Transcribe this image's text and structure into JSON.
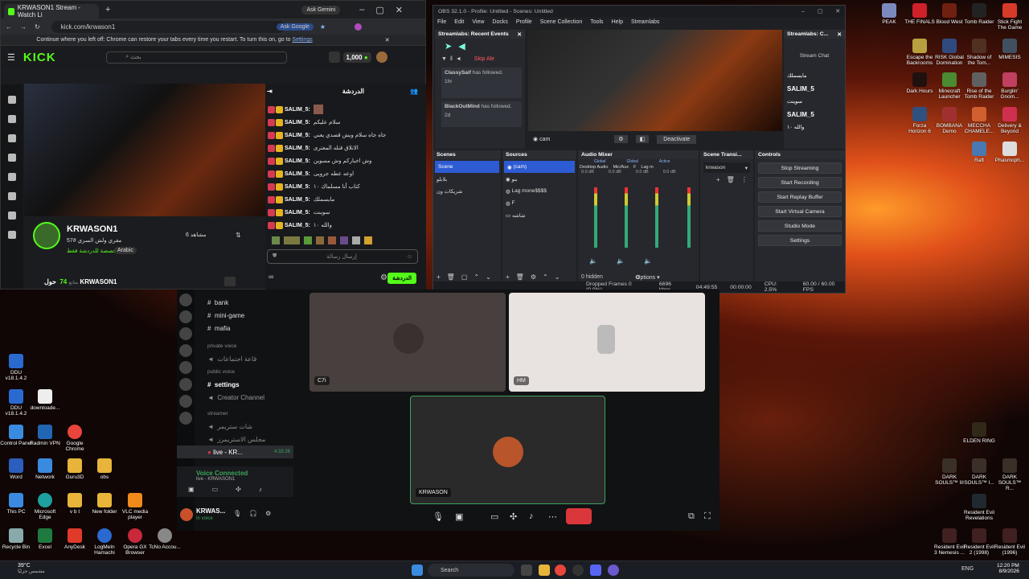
{
  "chrome": {
    "tab_title": "KRWASON1 Stream - Watch Li",
    "ask_gemini": "Ask Gemini",
    "url": "kick.com/krwason1",
    "ask_google": "Ask Google",
    "infobar": "Continue where you left off: Chrome can restore your tabs every time you restart. To turn this on, go to",
    "infobar_link": "Settings",
    "search_placeholder": "بحث",
    "coins": "1,000",
    "chat_title": "الدردشة",
    "streamer": "KRWASON1",
    "stream_title": "مفري ولش السري #57",
    "category": "مخصصة للدردشة فقط",
    "lang": "Arabic",
    "viewers": "6 مشاهد",
    "about": "حول KRWASON1",
    "followers_count": "74",
    "followers_label": "متابع",
    "chat_placeholder": "إرسال رسالة",
    "send_label": "الدردشة",
    "messages": [
      {
        "user": "SALIM_5:",
        "text": ""
      },
      {
        "user": "SALIM_5:",
        "text": "سلام عليكم"
      },
      {
        "user": "SALIM_5:",
        "text": "جاه جاه سلام ويش قصدي يعني"
      },
      {
        "user": "SALIM_5:",
        "text": "الاتلاق قتله المعترى"
      },
      {
        "user": "SALIM_5:",
        "text": "وش اخبارکم وش مسوين"
      },
      {
        "user": "SALIM_5:",
        "text": "اوعه عطه جرويى"
      },
      {
        "user": "SALIM_5:",
        "text": "كتاب أنا مسلماك ١٠"
      },
      {
        "user": "SALIM_5:",
        "text": "مايسملك"
      },
      {
        "user": "SALIM_5:",
        "text": "سوينت"
      },
      {
        "user": "SALIM_5:",
        "text": "والله ١٠"
      }
    ]
  },
  "obs": {
    "title": "OBS 32.1.0 - Profile: Untitled - Scenes: Untitled",
    "menu": [
      "File",
      "Edit",
      "View",
      "Docks",
      "Profile",
      "Scene Collection",
      "Tools",
      "Help",
      "Streamlabs"
    ],
    "events_title": "Streamlabs: Recent Events",
    "skip_label": "Skip Ale",
    "events": [
      {
        "name": "ClassySaif",
        "action": "has followed.",
        "time": "1hr"
      },
      {
        "name": "BlackOutMind",
        "action": "has followed.",
        "time": "2d"
      }
    ],
    "chat_dock_title": "Streamlabs: C...",
    "stream_chat": "Stream Chat",
    "chat_lines": [
      "مايسملك",
      "SALIM_5",
      "سوينت",
      "SALIM_5",
      "والله ١٠"
    ],
    "preview_source": "cam",
    "deactivate": "Deactivate",
    "scenes_title": "Scenes",
    "scenes": [
      "Scene",
      "بلابلو",
      "شريكات ون"
    ],
    "sources_title": "Sources",
    "sources": [
      "(cam)",
      "بنو",
      "Lag mone$$$$",
      "F",
      "شاشه"
    ],
    "mixer_title": "Audio Mixer",
    "mixer_tags": [
      "Global",
      "Global",
      "Active"
    ],
    "channels": [
      "Desktop Audio",
      "Mic/Aux",
      "F",
      "Lag m"
    ],
    "channel_db": [
      "0.0 dB",
      "0.0 dB",
      "0.0 dB",
      "0.0 dB"
    ],
    "hidden": "0 hidden",
    "transitions_title": "Scene Transi...",
    "transition": "krwason",
    "options": "Options",
    "controls_title": "Controls",
    "controls": [
      "Stop Streaming",
      "Start Recording",
      "Start Replay Buffer",
      "Start Virtual Camera",
      "Studio Mode",
      "Settings"
    ],
    "status": {
      "dropped": "Dropped Frames 0 (0.0%)",
      "kbps": "6696 kbps",
      "live": "04:49:55",
      "rec": "00:00:00",
      "cpu": "CPU: 2.5%",
      "fps": "60.00 / 60.00 FPS"
    }
  },
  "discord": {
    "channels": [
      {
        "type": "text",
        "label": "bank"
      },
      {
        "type": "text",
        "label": "mini-game"
      },
      {
        "type": "text",
        "label": "mafia"
      },
      {
        "type": "category",
        "label": "private voice"
      },
      {
        "type": "voice",
        "label": "قاعة اجتماعات"
      },
      {
        "type": "category",
        "label": "public voice"
      },
      {
        "type": "text",
        "label": "settings"
      },
      {
        "type": "voice",
        "label": "Creator Channel"
      },
      {
        "type": "category",
        "label": "streamer"
      },
      {
        "type": "voice",
        "label": "شات ستريمر"
      },
      {
        "type": "voice",
        "label": "مجلس الاستريمرز"
      },
      {
        "type": "live",
        "label": "live - KR..."
      }
    ],
    "live_timer": "4:33:26",
    "voice_status": "Voice Connected",
    "voice_sub": "live - KRWASON1",
    "username": "KRWAS...",
    "user_status": "In voice",
    "tiles": [
      "C7i",
      "HM",
      "KRWASON"
    ],
    "server_badges": [
      "39",
      "393",
      "28"
    ]
  },
  "desktop": {
    "left_icons": [
      "DDU v18.1.4.2",
      "DDU v18.1.4.2",
      "downloade...",
      "Control Panel",
      "Radmin VPN",
      "Google Chrome",
      "Word",
      "Network",
      "Guru3D",
      "obs",
      "This PC",
      "Microsoft Edge",
      "v b t",
      "New folder",
      "VLC media player",
      "Recycle Bin",
      "Excel",
      "AnyDesk",
      "LogMeIn Hamachi",
      "Opera GX Browser",
      "TcNo Accou..."
    ],
    "right_icons": [
      "PEAK",
      "THE FINALS",
      "Blood West",
      "Tomb Raider",
      "Stick Fight The Game",
      "Escape the Backrooms",
      "RISK Global Domination",
      "Shadow of the Tom...",
      "MIMESIS",
      "Dark Hours",
      "Minecraft Launcher",
      "Rise of the Tomb Raider",
      "Burglin' Gnom...",
      "Forza Horizon 6",
      "BOMBANA Demo",
      "MECCHA CHAMELE...",
      "Delivery & Beyond",
      "Raft",
      "Phasmoph...",
      "ELDEN RING",
      "DARK SOULS™ III",
      "DARK SOULS™ I...",
      "DARK SOULS™ R...",
      "Resident Evil Revelations",
      "Resident Evil 3 Nemesis ...",
      "Resident Evil 2 (1998)",
      "Resident Evil (1996)"
    ]
  },
  "taskbar": {
    "weather": "39°C",
    "weather_sub": "مشمس جزئيًا",
    "search": "Search",
    "lang": "ENG",
    "time": "12:20 PM",
    "date": "8/9/2026"
  },
  "colors": {
    "kick_green": "#53fc18",
    "obs_blue": "#2d5bd3",
    "discord_red": "#da373c",
    "accent_red": "#d63a52"
  }
}
